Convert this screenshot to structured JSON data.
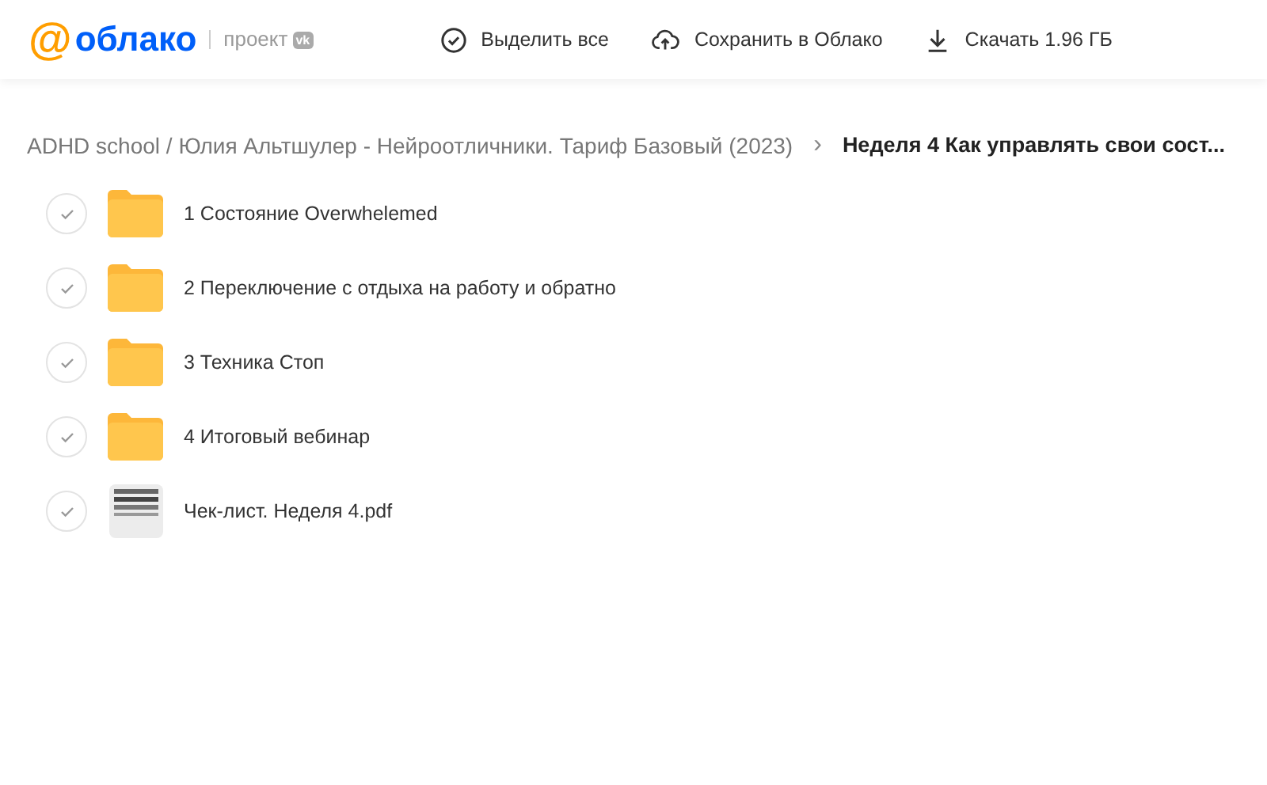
{
  "header": {
    "logo_symbol": "@",
    "logo_text": "облако",
    "project_label": "проект",
    "project_badge": "vk",
    "actions": [
      {
        "kind": "select",
        "label": "Выделить все"
      },
      {
        "kind": "save",
        "label": "Сохранить в Облако"
      },
      {
        "kind": "download",
        "label": "Скачать 1.96 ГБ"
      }
    ]
  },
  "breadcrumb": {
    "path": "ADHD school / Юлия Альтшулер - Нейроотличники. Тариф Базовый (2023)",
    "separator": "›",
    "current": "Неделя 4 Как управлять свои сост..."
  },
  "items": [
    {
      "kind": "folder",
      "name": "1 Состояние Overwhelemed",
      "selected": false
    },
    {
      "kind": "folder",
      "name": "2 Переключение с отдыха на работу и обратно",
      "selected": false
    },
    {
      "kind": "folder",
      "name": "3 Техника Стоп",
      "selected": false
    },
    {
      "kind": "folder",
      "name": "4 Итоговый вебинар",
      "selected": false
    },
    {
      "kind": "file",
      "name": "Чек-лист. Неделя 4.pdf",
      "selected": false
    }
  ]
}
